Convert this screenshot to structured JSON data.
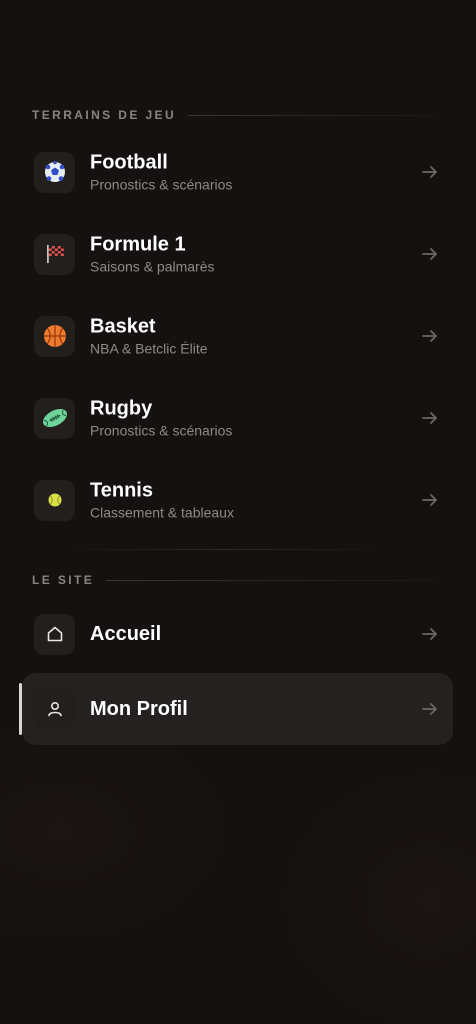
{
  "sections": {
    "games": {
      "title": "TERRAINS DE JEU"
    },
    "site": {
      "title": "LE SITE"
    }
  },
  "games": [
    {
      "title": "Football",
      "subtitle": "Pronostics & scénarios",
      "icon": "soccer-ball-icon"
    },
    {
      "title": "Formule 1",
      "subtitle": "Saisons & palmarès",
      "icon": "checkered-flag-icon"
    },
    {
      "title": "Basket",
      "subtitle": "NBA & Betclic Élite",
      "icon": "basketball-icon"
    },
    {
      "title": "Rugby",
      "subtitle": "Pronostics & scénarios",
      "icon": "rugby-ball-icon"
    },
    {
      "title": "Tennis",
      "subtitle": "Classement & tableaux",
      "icon": "tennis-ball-icon"
    }
  ],
  "site": [
    {
      "title": "Accueil",
      "icon": "home-icon",
      "active": false
    },
    {
      "title": "Mon Profil",
      "icon": "user-icon",
      "active": true
    }
  ],
  "colors": {
    "background": "#141110",
    "active_item": "#242120",
    "muted_text": "#8f8a86",
    "basketball": "#f07a2c",
    "rugby": "#6fd39a",
    "tennis": "#d9e04a",
    "football": "#3a5bd6",
    "f1_flag": "#e0524a"
  }
}
